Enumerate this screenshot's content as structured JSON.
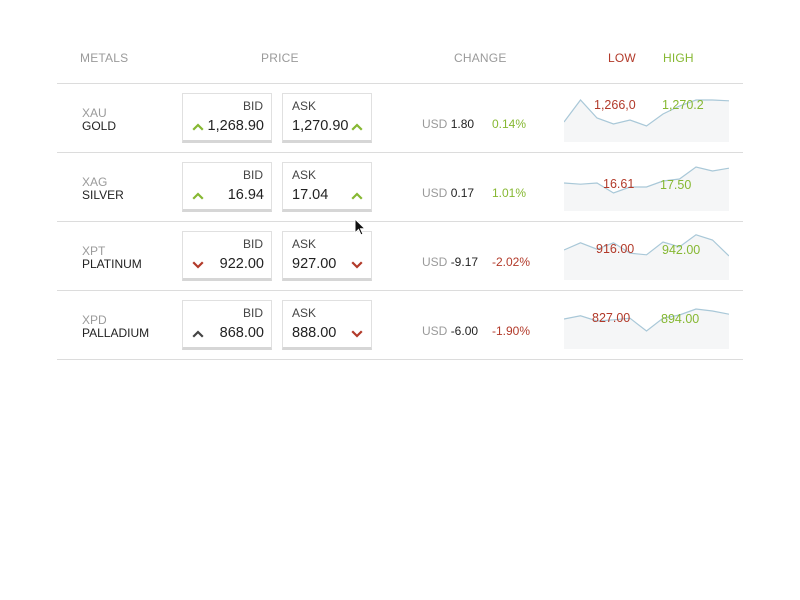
{
  "header": {
    "metals": "METALS",
    "price": "PRICE",
    "change": "CHANGE",
    "low": "LOW",
    "high": "HIGH"
  },
  "colors": {
    "up": "#86b832",
    "down": "#b23a2a",
    "neutral": "#444444",
    "spark_line": "#a9c8d8",
    "spark_fill": "#f5f6f7"
  },
  "labels": {
    "bid": "BID",
    "ask": "ASK",
    "currency": "USD"
  },
  "rows": [
    {
      "symbol": "XAU",
      "name": "GOLD",
      "bid": "1,268.90",
      "bid_dir": "up",
      "ask": "1,270.90",
      "ask_dir": "up",
      "change_usd": "1.80",
      "change_pct": "0.14%",
      "change_dir": "up",
      "low": "1,266,0",
      "high": "1,270.2",
      "spark": [
        0.35,
        0.9,
        0.45,
        0.3,
        0.4,
        0.25,
        0.55,
        0.75,
        0.9,
        0.9,
        0.88
      ]
    },
    {
      "symbol": "XAG",
      "name": "SILVER",
      "bid": "16.94",
      "bid_dir": "up",
      "ask": "17.04",
      "ask_dir": "up",
      "change_usd": "0.17",
      "change_pct": "1.01%",
      "change_dir": "up",
      "low": "16.61",
      "high": "17.50",
      "spark": [
        0.55,
        0.52,
        0.55,
        0.3,
        0.45,
        0.45,
        0.6,
        0.65,
        0.95,
        0.85,
        0.92
      ]
    },
    {
      "symbol": "XPT",
      "name": "PLATINUM",
      "bid": "922.00",
      "bid_dir": "down",
      "ask": "927.00",
      "ask_dir": "down",
      "change_usd": "-9.17",
      "change_pct": "-2.02%",
      "change_dir": "down",
      "low": "916.00",
      "high": "942.00",
      "spark": [
        0.6,
        0.78,
        0.62,
        0.78,
        0.52,
        0.48,
        0.8,
        0.68,
        0.98,
        0.85,
        0.45
      ]
    },
    {
      "symbol": "XPD",
      "name": "PALLADIUM",
      "bid": "868.00",
      "bid_dir": "neutral",
      "ask": "888.00",
      "ask_dir": "down",
      "change_usd": "-6.00",
      "change_pct": "-1.90%",
      "change_dir": "down",
      "low": "827.00",
      "high": "894.00",
      "spark": [
        0.6,
        0.68,
        0.55,
        0.58,
        0.62,
        0.3,
        0.62,
        0.7,
        0.85,
        0.8,
        0.72
      ]
    }
  ]
}
